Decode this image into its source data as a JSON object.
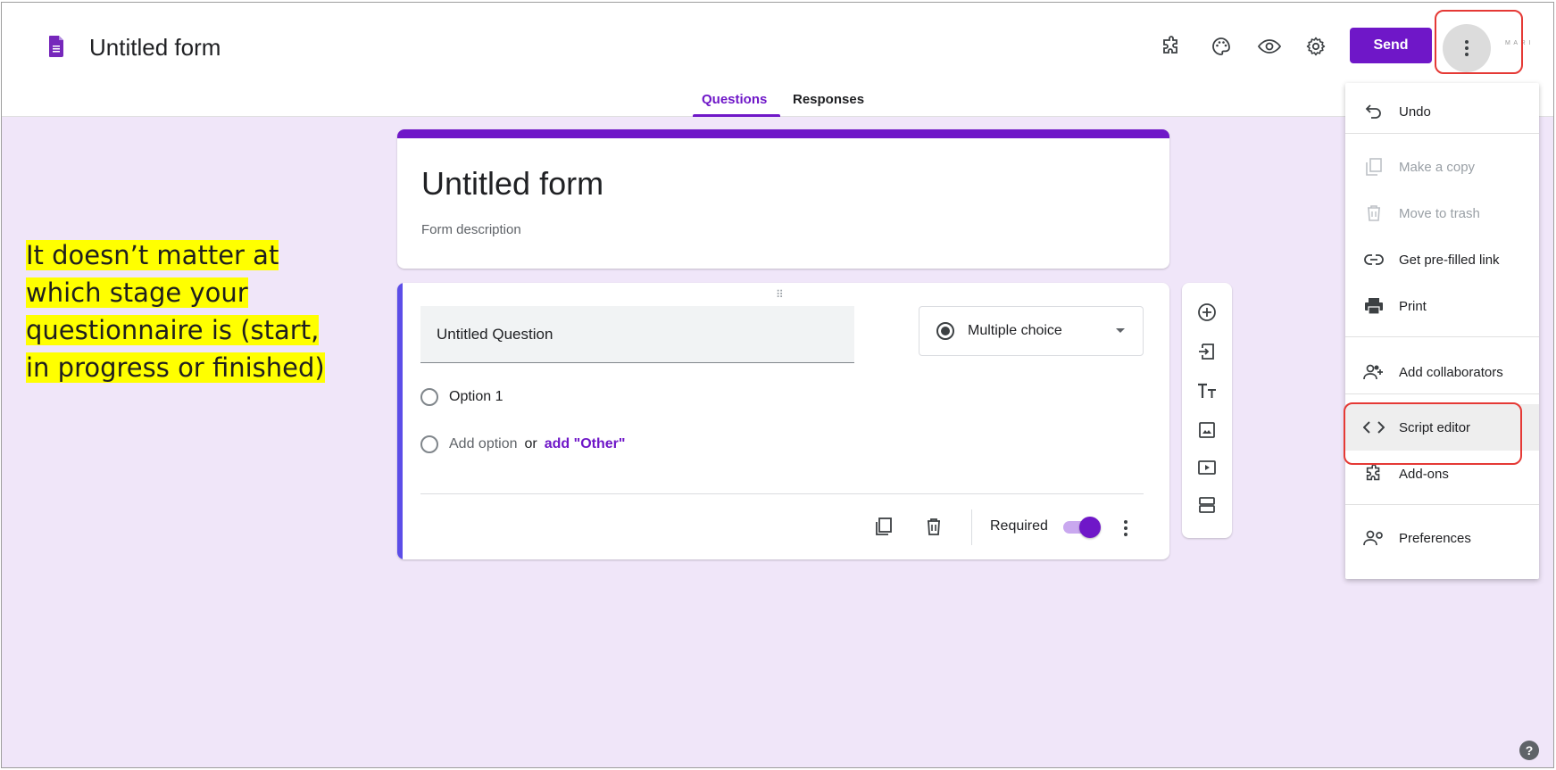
{
  "header": {
    "app_title": "Untitled form",
    "send_label": "Send",
    "avatar_text": "M A R I",
    "icons": [
      "puzzle-icon",
      "palette-icon",
      "eye-icon",
      "gear-icon",
      "more-vert-icon"
    ]
  },
  "tabs": [
    {
      "label": "Questions",
      "active": true
    },
    {
      "label": "Responses",
      "active": false
    }
  ],
  "annotation": {
    "lines": [
      "It doesn’t matter at",
      "which stage your",
      "questionnaire is (start,",
      "in progress or finished)"
    ]
  },
  "form": {
    "title": "Untitled form",
    "description_placeholder": "Form description"
  },
  "question": {
    "title": "Untitled Question",
    "type": "Multiple choice",
    "options": [
      "Option 1"
    ],
    "add_option": "Add option",
    "or": "or",
    "add_other": "add \"Other\"",
    "required_label": "Required",
    "required": true
  },
  "menu": {
    "items": [
      {
        "label": "Undo",
        "icon": "undo-icon",
        "disabled": false
      },
      {
        "label": "Make a copy",
        "icon": "copy-icon",
        "disabled": true
      },
      {
        "label": "Move to trash",
        "icon": "trash-icon",
        "disabled": true
      },
      {
        "label": "Get pre-filled link",
        "icon": "link-icon",
        "disabled": false
      },
      {
        "label": "Print",
        "icon": "print-icon",
        "disabled": false
      },
      {
        "label": "Add collaborators",
        "icon": "add-people-icon",
        "disabled": false
      },
      {
        "label": "Script editor",
        "icon": "code-icon",
        "disabled": false
      },
      {
        "label": "Add-ons",
        "icon": "puzzle-icon",
        "disabled": false
      },
      {
        "label": "Preferences",
        "icon": "person-settings-icon",
        "disabled": false
      }
    ]
  },
  "help_label": "?",
  "colors": {
    "accent": "#6f17c8",
    "background": "#f0e6f9",
    "highlight": "#ffff00",
    "callout": "#e53935"
  }
}
